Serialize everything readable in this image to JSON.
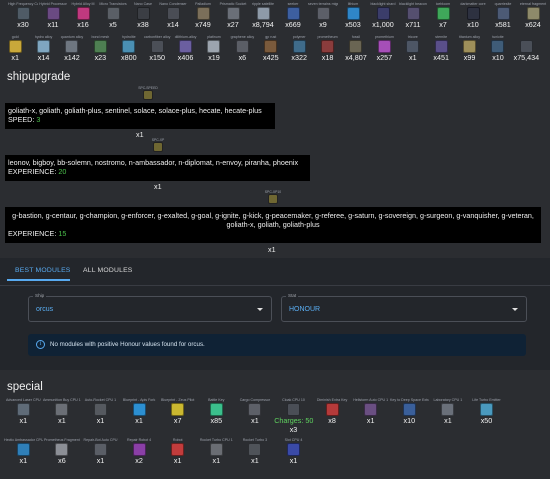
{
  "top_items": [
    {
      "name": "High Frequency Cable",
      "qty": "x30",
      "color": "#4f5b66"
    },
    {
      "name": "Hybrid Processor",
      "qty": "x11",
      "color": "#6a4a82"
    },
    {
      "name": "Hybrid Alloy M",
      "qty": "x16",
      "color": "#c0397f"
    },
    {
      "name": "Micro Transistors",
      "qty": "x5",
      "color": "#5a5f66"
    },
    {
      "name": "Nano Case",
      "qty": "x38",
      "color": "#3b3e44"
    },
    {
      "name": "Nano Condenser",
      "qty": "x14",
      "color": "#4a4d55"
    },
    {
      "name": "Palladium",
      "qty": "x749",
      "color": "#7b6f5a"
    },
    {
      "name": "Prismatic Socket",
      "qty": "x27",
      "color": "#6a6f78"
    },
    {
      "name": "ripple satellite",
      "qty": "x8,794",
      "color": "#8e9aa8"
    },
    {
      "name": "seeker",
      "qty": "x669",
      "color": "#3d5fa0"
    },
    {
      "name": "seven terrains migration",
      "qty": "x9",
      "color": "#5c5f68"
    },
    {
      "name": "lithium",
      "qty": "x503",
      "color": "#2f86c8"
    },
    {
      "name": "blacklight shard",
      "qty": "x1,000",
      "color": "#3b3d6a"
    },
    {
      "name": "blacklight beacon",
      "qty": "x711",
      "color": "#554f6f"
    },
    {
      "name": "icebloom",
      "qty": "x7",
      "color": "#3fa85a"
    },
    {
      "name": "darkmatter core",
      "qty": "x10",
      "color": "#2d3140"
    },
    {
      "name": "quarriesite",
      "qty": "x581",
      "color": "#4c5a75"
    },
    {
      "name": "eternal fragment",
      "qty": "x624",
      "color": "#8e8a6a"
    },
    {
      "name": "gold",
      "qty": "x1",
      "color": "#c9a83a"
    },
    {
      "name": "hydro alloy",
      "qty": "x14",
      "color": "#7fa6c0"
    },
    {
      "name": "quantum alloy",
      "qty": "x142",
      "color": "#6e7680"
    },
    {
      "name": "bond mesh",
      "qty": "x23",
      "color": "#4e7f52"
    },
    {
      "name": "hydrolite",
      "qty": "x800",
      "color": "#4a8fb3"
    },
    {
      "name": "carbonfiber alloy",
      "qty": "x150",
      "color": "#4b4f57"
    },
    {
      "name": "dilithium-alloy",
      "qty": "x406",
      "color": "#6b5fa0"
    },
    {
      "name": "platinum",
      "qty": "x19",
      "color": "#9ca4ae"
    },
    {
      "name": "graphene alloy",
      "qty": "x6",
      "color": "#5b5e66"
    },
    {
      "name": "gp rust",
      "qty": "x425",
      "color": "#7a5a3c"
    },
    {
      "name": "polymer",
      "qty": "x322",
      "color": "#3f6b8a"
    },
    {
      "name": "prometheum",
      "qty": "x18",
      "color": "#8a3c3c"
    },
    {
      "name": "fossil",
      "qty": "x4,807",
      "color": "#6a6553"
    },
    {
      "name": "promethium",
      "qty": "x257",
      "color": "#a64fb8"
    },
    {
      "name": "tricore",
      "qty": "x1",
      "color": "#4d5665"
    },
    {
      "name": "sternite",
      "qty": "x451",
      "color": "#5a4f8a"
    },
    {
      "name": "titanium alloy",
      "qty": "x99",
      "color": "#9e8f5a"
    },
    {
      "name": "tunicite",
      "qty": "x10",
      "color": "#3f5c78"
    },
    {
      "name": "",
      "qty": "x75,434",
      "color": "#4a4f58"
    }
  ],
  "shipupgrade": {
    "heading": "shipupgrade",
    "blocks": [
      {
        "item_name": "SPC-SPEED",
        "text": "goliath-x, goliath, goliath-plus, sentinel, solace, solace-plus, hecate, hecate-plus",
        "stat_label": "SPEED: ",
        "stat_value": "3",
        "count": "x1"
      },
      {
        "item_name": "SPC-XP",
        "text": "leonov, bigboy, bb-solemn, nostromo, n-ambassador, n-diplomat, n-envoy, piranha, phoenix",
        "stat_label": "EXPERIENCE: ",
        "stat_value": "20",
        "count": "x1"
      },
      {
        "item_name": "SPC-XP10",
        "text": "g-bastion, g-centaur, g-champion, g-enforcer, g-exalted, g-goal, g-ignite, g-kick, g-peacemaker, g-referee, g-saturn, g-sovereign, g-surgeon, g-vanquisher, g-veteran, goliath-x, goliath, goliath-plus",
        "stat_label": "EXPERIENCE: ",
        "stat_value": "15",
        "count": "x1"
      }
    ]
  },
  "modules": {
    "tabs": [
      "BEST MODULES",
      "ALL MODULES"
    ],
    "active_tab": "BEST MODULES",
    "ship_select": {
      "label": "Ship",
      "value": "orcus"
    },
    "stat_select": {
      "label": "Stat",
      "value": "HONOUR"
    },
    "alert": "No modules with positive Honour values found for orcus."
  },
  "special": {
    "heading": "special",
    "items": [
      {
        "name": "Advanced Laser CPU",
        "qty": "x1",
        "color": "#5f6b78"
      },
      {
        "name": "Ammunition Buy CPU 1",
        "qty": "x1",
        "color": "#6b6f76"
      },
      {
        "name": "Auto-Rocket CPU 1",
        "qty": "x1",
        "color": "#55595f"
      },
      {
        "name": "Blueprint - Apis Fork",
        "qty": "x1",
        "color": "#2c8fd1"
      },
      {
        "name": "Blueprint - Zeus Pilot",
        "qty": "x7",
        "color": "#cbb830"
      },
      {
        "name": "Battle Key",
        "qty": "x85",
        "color": "#3bbf8c"
      },
      {
        "name": "Cargo Compressor",
        "qty": "x1",
        "color": "#5d6068"
      },
      {
        "name": "Cloak CPU 10",
        "qty": "",
        "color": "#4a4e56",
        "extra": "Charges: 50",
        "extra_qty": "x3"
      },
      {
        "name": "Diminish Extra Key",
        "qty": "x8",
        "color": "#b53a3a"
      },
      {
        "name": "Hellstorm Auto CPU 1",
        "qty": "x1",
        "color": "#6a4f82"
      },
      {
        "name": "Key to Deep Space Extractor",
        "qty": "x10",
        "color": "#3a5f9a"
      },
      {
        "name": "Laboratory CPU 1",
        "qty": "x1",
        "color": "#6a707a"
      },
      {
        "name": "Life Turbo Emitter",
        "qty": "x50",
        "color": "#4a9abf"
      },
      {
        "name": "Hectic Ambassador CPU",
        "qty": "x1",
        "color": "#2f7fb8"
      },
      {
        "name": "Prometheus Fragment",
        "qty": "x6",
        "color": "#8c8f96"
      },
      {
        "name": "Repair-Bot Auto CPU",
        "qty": "x1",
        "color": "#5a5e66"
      },
      {
        "name": "Repair Robot 4",
        "qty": "x2",
        "color": "#8a3fa6"
      },
      {
        "name": "Robot",
        "qty": "x1",
        "color": "#c23c3c"
      },
      {
        "name": "Rocket Turbo CPU 1",
        "qty": "x1",
        "color": "#6a6d73"
      },
      {
        "name": "Rocket Turbo 3",
        "qty": "x1",
        "color": "#4f5359"
      },
      {
        "name": "Slot CPU 4",
        "qty": "x1",
        "color": "#3a4aa8"
      }
    ]
  }
}
